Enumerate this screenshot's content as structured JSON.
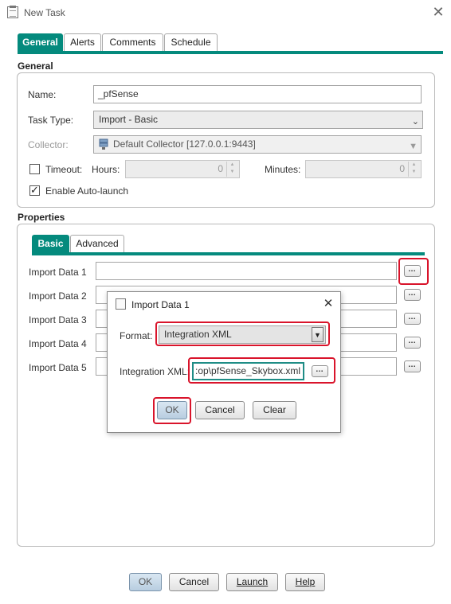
{
  "window": {
    "title": "New Task",
    "close_glyph": "✕"
  },
  "tabs": [
    "General",
    "Alerts",
    "Comments",
    "Schedule"
  ],
  "general": {
    "section_title": "General",
    "name_label": "Name:",
    "name_value": "_pfSense",
    "task_type_label": "Task Type:",
    "task_type_value": "Import - Basic",
    "collector_label": "Collector:",
    "collector_value": "Default Collector  [127.0.0.1:9443]",
    "timeout_label": "Timeout:",
    "timeout_checked": false,
    "hours_label": "Hours:",
    "hours_value": "0",
    "minutes_label": "Minutes:",
    "minutes_value": "0",
    "auto_launch_label": "Enable Auto-launch",
    "auto_launch_checked": true
  },
  "properties": {
    "section_title": "Properties",
    "tabs": [
      "Basic",
      "Advanced"
    ],
    "rows": [
      {
        "label": "Import Data 1",
        "value": ""
      },
      {
        "label": "Import Data 2",
        "value": ""
      },
      {
        "label": "Import Data 3",
        "value": ""
      },
      {
        "label": "Import Data 4",
        "value": ""
      },
      {
        "label": "Import Data 5",
        "value": ""
      }
    ],
    "browse_glyph": "…"
  },
  "dialog": {
    "title": "Import Data 1",
    "close_glyph": "✕",
    "format_label": "Format:",
    "format_value": "Integration XML",
    "xml_label": "Integration XML:",
    "xml_value": ":op\\pfSense_Skybox.xml",
    "browse_glyph": "…",
    "ok_label": "OK",
    "cancel_label": "Cancel",
    "clear_label": "Clear"
  },
  "footer": {
    "ok_label": "OK",
    "cancel_label": "Cancel",
    "launch_label": "Launch",
    "help_label": "Help"
  },
  "colors": {
    "accent": "#048a7d",
    "highlight": "#d9142b"
  }
}
